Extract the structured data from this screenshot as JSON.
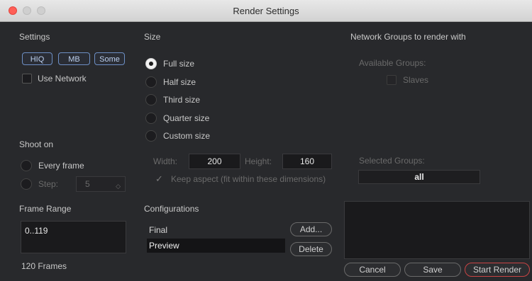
{
  "window": {
    "title": "Render Settings"
  },
  "settings": {
    "header": "Settings",
    "hiq": "HIQ",
    "mb": "MB",
    "some": "Some",
    "use_network": "Use Network"
  },
  "size": {
    "header": "Size",
    "options": [
      "Full size",
      "Half size",
      "Third size",
      "Quarter size",
      "Custom size"
    ],
    "selected": "Full size",
    "width_label": "Width:",
    "width_value": "200",
    "height_label": "Height:",
    "height_value": "160",
    "keep_aspect": "Keep aspect (fit within these dimensions)"
  },
  "network": {
    "header": "Network Groups to render with",
    "available_label": "Available Groups:",
    "slaves": "Slaves",
    "selected_label": "Selected Groups:",
    "selected_value": "all"
  },
  "shoot_on": {
    "header": "Shoot on",
    "every_frame": "Every frame",
    "step_label": "Step:",
    "step_value": "5"
  },
  "frame_range": {
    "header": "Frame Range",
    "value": "0..119",
    "frames": "120 Frames"
  },
  "configurations": {
    "header": "Configurations",
    "items": [
      "Final",
      "Preview"
    ],
    "selected": "Preview",
    "add": "Add...",
    "delete": "Delete"
  },
  "buttons": {
    "cancel": "Cancel",
    "save": "Save",
    "start_render": "Start Render"
  },
  "colors": {
    "accent_blue": "#6d8fc4",
    "start_render_border": "#c94444",
    "background": "#28292c"
  }
}
